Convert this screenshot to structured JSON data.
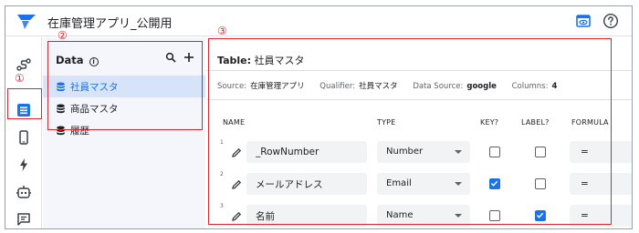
{
  "app": {
    "title": "在庫管理アプリ_公開用"
  },
  "topbar": {
    "preview_icon": "preview-icon",
    "help_icon": "help-icon"
  },
  "rail": {
    "items": [
      {
        "icon": "route-icon"
      },
      {
        "icon": "data-icon",
        "active": true
      },
      {
        "icon": "phone-icon"
      },
      {
        "icon": "lightning-icon"
      },
      {
        "icon": "bot-icon"
      },
      {
        "icon": "chat-icon"
      }
    ]
  },
  "data_panel": {
    "title": "Data",
    "info_glyph": "i",
    "items": [
      {
        "label": "社員マスタ",
        "active": true
      },
      {
        "label": "商品マスタ"
      },
      {
        "label": "履歴"
      }
    ]
  },
  "table": {
    "title_prefix": "Table:",
    "title_name": "社員マスタ",
    "meta": {
      "source_label": "Source:",
      "source_value": "在庫管理アプリ",
      "qualifier_label": "Qualifier:",
      "qualifier_value": "社員マスタ",
      "datasource_label": "Data Source:",
      "datasource_value": "google",
      "columns_label": "Columns:",
      "columns_value": "4"
    },
    "headers": {
      "name": "NAME",
      "type": "TYPE",
      "key": "KEY?",
      "label": "LABEL?",
      "formula": "FORMULA"
    },
    "rows": [
      {
        "num": "1",
        "name": "_RowNumber",
        "type": "Number",
        "key": false,
        "label": false,
        "formula": "="
      },
      {
        "num": "2",
        "name": "メールアドレス",
        "type": "Email",
        "key": true,
        "label": false,
        "formula": "="
      },
      {
        "num": "3",
        "name": "名前",
        "type": "Name",
        "key": false,
        "label": true,
        "formula": "="
      }
    ]
  },
  "annotations": {
    "one": "①",
    "two": "②",
    "three": "③"
  },
  "colors": {
    "accent": "#1a73e8",
    "annotation": "#d9262c",
    "panel_bg": "#f5f6fc",
    "selected_bg": "#d6e3f8"
  }
}
